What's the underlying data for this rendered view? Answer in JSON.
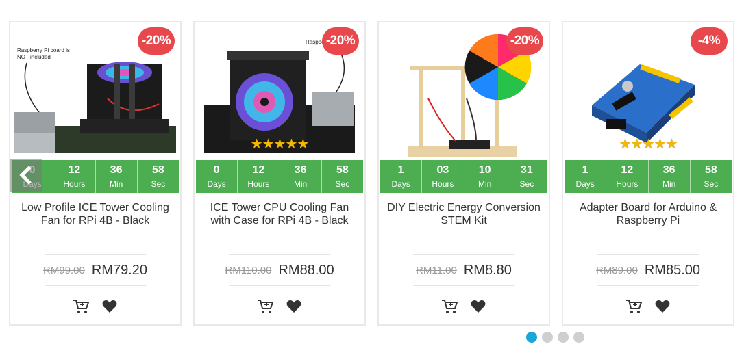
{
  "colors": {
    "badge": "#e8474b",
    "countdown_bar": "#4cae50",
    "star": "#f5b800",
    "dot_active": "#1aa6d8",
    "dot_inactive": "#cfcfcf"
  },
  "products": [
    {
      "discount": "-20%",
      "image_note": "Raspberry Pi board is NOT included",
      "stars": "",
      "countdown": [
        {
          "value": "0",
          "label": "Days"
        },
        {
          "value": "12",
          "label": "Hours"
        },
        {
          "value": "36",
          "label": "Min"
        },
        {
          "value": "58",
          "label": "Sec"
        }
      ],
      "title": "Low Profile ICE Tower Cooling Fan for RPi 4B - Black",
      "old_price": "RM99.00",
      "price": "RM79.20",
      "rating": 0
    },
    {
      "discount": "-20%",
      "image_note": "Raspberry Pi",
      "stars": "★★★★★",
      "countdown": [
        {
          "value": "0",
          "label": "Days"
        },
        {
          "value": "12",
          "label": "Hours"
        },
        {
          "value": "36",
          "label": "Min"
        },
        {
          "value": "58",
          "label": "Sec"
        }
      ],
      "title": "ICE Tower CPU Cooling Fan with Case for RPi 4B - Black",
      "old_price": "RM110.00",
      "price": "RM88.00",
      "rating": 5
    },
    {
      "discount": "-20%",
      "stars": "",
      "countdown": [
        {
          "value": "1",
          "label": "Days"
        },
        {
          "value": "03",
          "label": "Hours"
        },
        {
          "value": "10",
          "label": "Min"
        },
        {
          "value": "31",
          "label": "Sec"
        }
      ],
      "title": "DIY Electric Energy Conversion STEM Kit",
      "old_price": "RM11.00",
      "price": "RM8.80",
      "rating": 0
    },
    {
      "discount": "-4%",
      "stars": "★★★★★",
      "countdown": [
        {
          "value": "1",
          "label": "Days"
        },
        {
          "value": "12",
          "label": "Hours"
        },
        {
          "value": "36",
          "label": "Min"
        },
        {
          "value": "58",
          "label": "Sec"
        }
      ],
      "title": "Adapter Board for Arduino & Raspberry Pi",
      "old_price": "RM89.00",
      "price": "RM85.00",
      "rating": 5
    }
  ],
  "icons": {
    "prev": "chevron-left-icon",
    "cart": "add-to-cart-icon",
    "wishlist": "heart-icon"
  },
  "pagination": {
    "pages": 4,
    "active": 1
  }
}
